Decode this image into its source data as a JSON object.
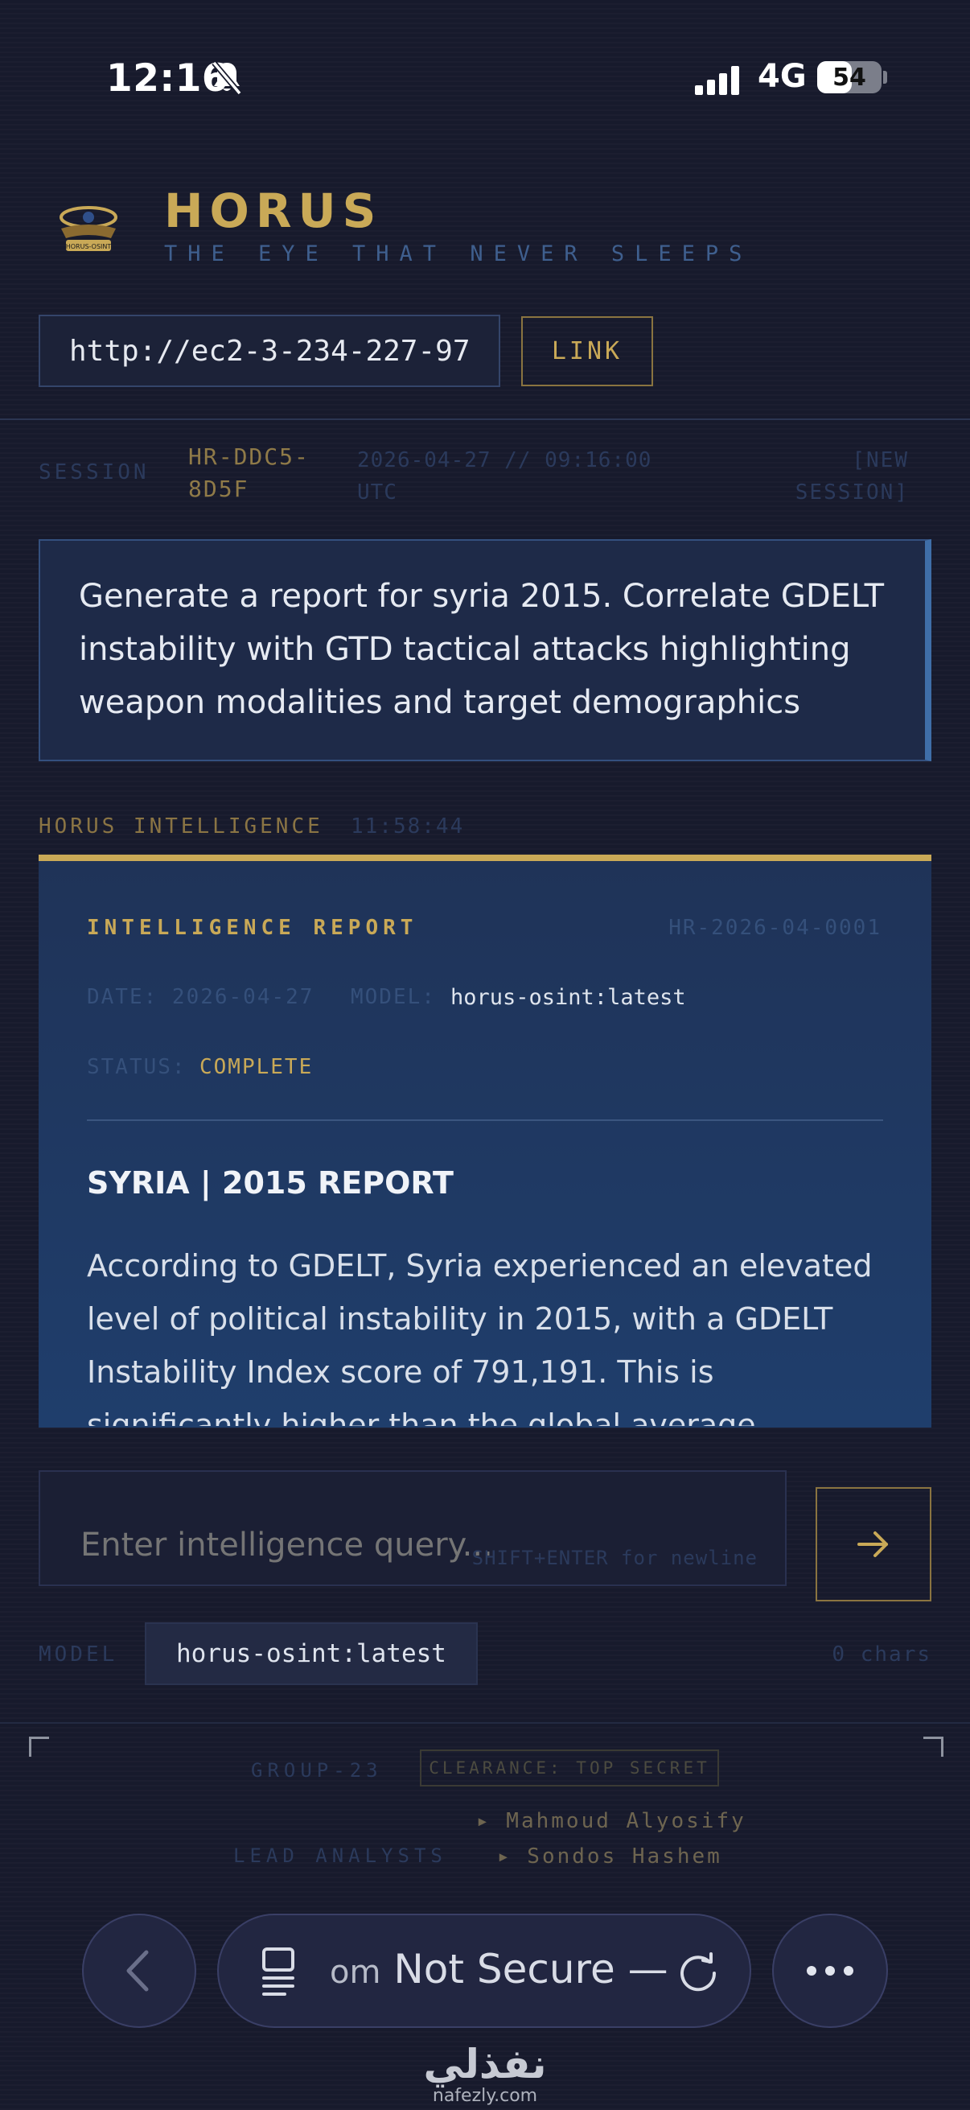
{
  "status_bar": {
    "time": "12:16",
    "network": "4G",
    "battery": "54",
    "battery_level": 0.54
  },
  "app": {
    "title": "HORUS",
    "subtitle": "THE EYE THAT NEVER SLEEPS",
    "logo_text": "HORUS-OSINT"
  },
  "url_bar": {
    "value": "http://ec2-3-234-227-97",
    "link_label": "LINK"
  },
  "session": {
    "label": "SESSION",
    "id": "HR-DDC5-8D5F",
    "datetime": "2026-04-27 // 09:16:00 UTC",
    "new_label": "[NEW SESSION]"
  },
  "query": "Generate a report for syria 2015. Correlate GDELT instability with GTD tactical attacks highlighting weapon modalities and target demographics",
  "response": {
    "source": "HORUS INTELLIGENCE",
    "time": "11:58:44"
  },
  "report": {
    "title": "INTELLIGENCE REPORT",
    "id": "HR-2026-04-0001",
    "date": "DATE: 2026-04-27",
    "model_label": "MODEL:",
    "model": "horus-osint:latest",
    "status_label": "STATUS:",
    "status": "COMPLETE",
    "heading": "SYRIA | 2015 REPORT",
    "body": "According to GDELT, Syria experienced an elevated level of political instability in 2015, with a GDELT Instability Index score of 791,191. This is significantly higher than the global average."
  },
  "input": {
    "placeholder": "Enter intelligence query...",
    "hint": "SHIFT+ENTER for newline",
    "model_label": "MODEL",
    "model": "horus-osint:latest",
    "chars": "0 chars"
  },
  "footer": {
    "group": "GROUP-23",
    "clearance": "CLEARANCE: TOP SECRET",
    "lead_label": "LEAD ANALYSTS",
    "analysts": [
      "▸ Mahmoud Alyosify",
      "▸ Sondos Hashem"
    ]
  },
  "browser": {
    "address_fragment": "om",
    "address": "Not Secure —"
  },
  "watermark": {
    "arabic": "نفذلي",
    "url": "nafezly.com"
  },
  "colors": {
    "gold": "#c9a957",
    "panel": "#1f3e6c",
    "background": "#171a2c"
  }
}
